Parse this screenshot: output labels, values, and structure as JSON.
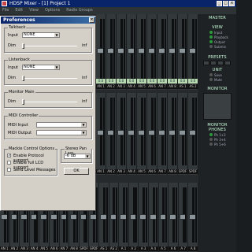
{
  "window": {
    "title": "HDSP Mixer - [1] Project 1"
  },
  "menu": [
    "File",
    "Edit",
    "View",
    "Options",
    "Radio Groups"
  ],
  "dialog": {
    "title": "Preferences",
    "talkback": {
      "label": "Talkback",
      "input_label": "Input",
      "input_value": "NONE",
      "dim_label": "Dim",
      "unit": "inf"
    },
    "listenback": {
      "label": "Listenback",
      "input_label": "Input",
      "input_value": "NONE",
      "dim_label": "Dim",
      "unit": "inf"
    },
    "monitor_main": {
      "label": "Monitor Main",
      "dim_label": "Dim",
      "unit": "inf"
    },
    "midi": {
      "label": "MIDI Controller",
      "input_label": "MIDI Input",
      "output_label": "MIDI Output"
    },
    "mackie": {
      "label": "Mackie Control Options",
      "opt1": "Enable Protocol support",
      "opt2": "Enable full LCD support",
      "opt3": "Send Level Messages"
    },
    "panlaw": {
      "label": "Stereo Pan Law",
      "value": "-6 dB"
    },
    "ok": "OK"
  },
  "panel": {
    "master": "MASTER",
    "view": "VIEW",
    "view_items": [
      "Input",
      "Playback",
      "Output",
      "Submix"
    ],
    "presets": "PRESETS",
    "unit": "UNIT",
    "save": "Save",
    "mute": "Mute",
    "monitor": "MONITOR",
    "monitor_phones": "MONITOR PHONES",
    "phones_vals": [
      "Ph 1+2",
      "Ph 3+4",
      "Ph 5+6"
    ]
  },
  "mixer": {
    "row1": [
      "AN 1",
      "AN 2",
      "AN 3",
      "AN 4",
      "AN 5",
      "AN 6",
      "AN 7",
      "AN 8",
      "AS 1",
      "AS 2",
      "A 1",
      "A 2",
      "A 3",
      "A 4",
      "A 5",
      "A 6",
      "A 7",
      "A 8"
    ],
    "row1_vals": [
      "0.0",
      "0.0",
      "0.0",
      "0.0",
      "0.0",
      "0.0",
      "0.0",
      "0.0",
      "0.0",
      "0.0",
      "0.0",
      "0.0",
      "0.0",
      "0.0",
      "0.0",
      "0.0",
      "0.0",
      "0.0"
    ],
    "row2": [
      "AN 1",
      "AN 2",
      "AN 3",
      "AN 4",
      "AN 5",
      "AN 6",
      "AN 7",
      "AN 8",
      "SPDF",
      "SPDF",
      "A 1",
      "A 2",
      "A 3",
      "A 4",
      "A 5",
      "A 6",
      "A 7",
      "A 8"
    ],
    "row3": [
      "AN 1",
      "AN 2",
      "AN 3",
      "AN 4",
      "AN 5",
      "AN 6",
      "AN 7",
      "AN 8",
      "SPDF",
      "SPDF",
      "AS 1",
      "AS 2",
      "A 1",
      "A 2",
      "A 3",
      "A 4",
      "A 5",
      "A 6",
      "A 7",
      "A 8"
    ]
  },
  "colors": {
    "title": "#0a246a",
    "dialog_bg": "#d4d0c8",
    "mixer_bg": "#262a2c",
    "value_box": "#b8d9b0"
  }
}
